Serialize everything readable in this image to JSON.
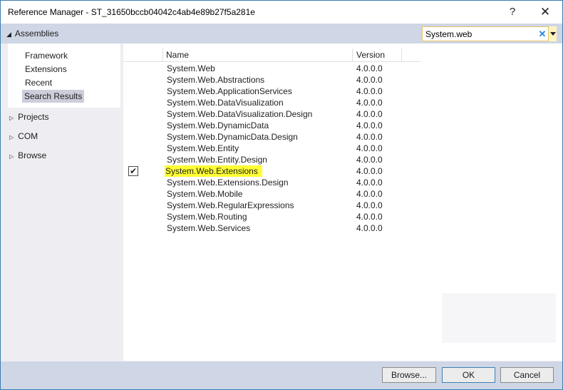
{
  "window": {
    "title": "Reference Manager - ST_31650bccb04042c4ab4e89b27f5a281e",
    "help_glyph": "?",
    "close_glyph": "✕"
  },
  "header": {
    "assemblies_label": "Assemblies",
    "expand_glyph": "◢"
  },
  "search": {
    "value": "System.web",
    "clear_glyph": "✕"
  },
  "left_nav": {
    "sub_items": [
      {
        "label": "Framework",
        "selected": false
      },
      {
        "label": "Extensions",
        "selected": false
      },
      {
        "label": "Recent",
        "selected": false
      },
      {
        "label": "Search Results",
        "selected": true
      }
    ],
    "groups": [
      {
        "label": "Projects"
      },
      {
        "label": "COM"
      },
      {
        "label": "Browse"
      }
    ],
    "collapsed_glyph": "▷"
  },
  "table": {
    "columns": {
      "name": "Name",
      "version": "Version"
    },
    "rows": [
      {
        "name": "System.Web",
        "version": "4.0.0.0",
        "checked": false,
        "highlight": false
      },
      {
        "name": "System.Web.Abstractions",
        "version": "4.0.0.0",
        "checked": false,
        "highlight": false
      },
      {
        "name": "System.Web.ApplicationServices",
        "version": "4.0.0.0",
        "checked": false,
        "highlight": false
      },
      {
        "name": "System.Web.DataVisualization",
        "version": "4.0.0.0",
        "checked": false,
        "highlight": false
      },
      {
        "name": "System.Web.DataVisualization.Design",
        "version": "4.0.0.0",
        "checked": false,
        "highlight": false
      },
      {
        "name": "System.Web.DynamicData",
        "version": "4.0.0.0",
        "checked": false,
        "highlight": false
      },
      {
        "name": "System.Web.DynamicData.Design",
        "version": "4.0.0.0",
        "checked": false,
        "highlight": false
      },
      {
        "name": "System.Web.Entity",
        "version": "4.0.0.0",
        "checked": false,
        "highlight": false
      },
      {
        "name": "System.Web.Entity.Design",
        "version": "4.0.0.0",
        "checked": false,
        "highlight": false
      },
      {
        "name": "System.Web.Extensions",
        "version": "4.0.0.0",
        "checked": true,
        "highlight": true
      },
      {
        "name": "System.Web.Extensions.Design",
        "version": "4.0.0.0",
        "checked": false,
        "highlight": false
      },
      {
        "name": "System.Web.Mobile",
        "version": "4.0.0.0",
        "checked": false,
        "highlight": false
      },
      {
        "name": "System.Web.RegularExpressions",
        "version": "4.0.0.0",
        "checked": false,
        "highlight": false
      },
      {
        "name": "System.Web.Routing",
        "version": "4.0.0.0",
        "checked": false,
        "highlight": false
      },
      {
        "name": "System.Web.Services",
        "version": "4.0.0.0",
        "checked": false,
        "highlight": false
      }
    ],
    "check_glyph": "✔"
  },
  "buttons": {
    "browse": "Browse...",
    "ok": "OK",
    "cancel": "Cancel"
  },
  "colors": {
    "highlight": "#ffff33",
    "accent": "#3c7fb1",
    "band": "#cfd6e5"
  }
}
